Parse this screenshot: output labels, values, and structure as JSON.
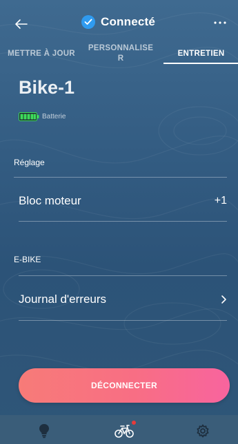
{
  "header": {
    "title": "Connecté",
    "back_icon": "back-arrow-icon",
    "status_icon": "check-circle-icon",
    "more_icon": "more-dots-icon"
  },
  "tabs": [
    {
      "label": "METTRE À JOUR",
      "active": false
    },
    {
      "label": "PERSONNALISER",
      "active": false
    },
    {
      "label": "ENTRETIEN",
      "active": true
    }
  ],
  "bike": {
    "name": "Bike-1",
    "battery_label": "Batterie",
    "battery_icon": "battery-icon",
    "battery_color": "#3ddc5a"
  },
  "sections": {
    "settings": {
      "label": "Réglage",
      "rows": [
        {
          "label": "Bloc moteur",
          "value": "+1"
        }
      ]
    },
    "ebike": {
      "label": "E-BIKE",
      "rows": [
        {
          "label": "Journal d'erreurs",
          "icon": "chevron-right-icon"
        }
      ]
    }
  },
  "actions": {
    "disconnect_label": "DÉCONNECTER",
    "disconnect_colors": [
      "#f77b78",
      "#f8649e"
    ]
  },
  "bottom_nav": [
    {
      "icon": "lightbulb-icon",
      "active": false
    },
    {
      "icon": "bicycle-icon",
      "active": true,
      "notification_dot": true
    },
    {
      "icon": "settings-gear-icon",
      "active": false
    }
  ],
  "colors": {
    "background": "#335c82",
    "accent_blue": "#2f9bf0",
    "notification": "#e83a3a"
  }
}
